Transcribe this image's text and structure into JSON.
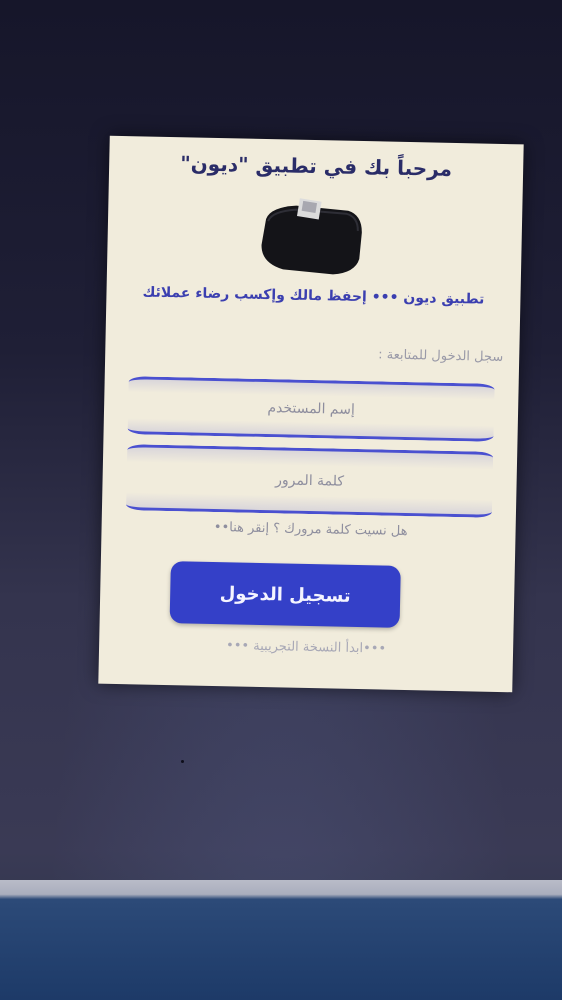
{
  "login": {
    "title": "مرحباً بك في تطبيق \"ديون\"",
    "printer_icon": "receipt-printer-icon",
    "tagline": "تطبيق ديون ••• إحفظ مالك وإكسب رضاء عملائك",
    "prompt": "سجل الدخول للمتابعة :",
    "username_placeholder": "إسم المستخدم",
    "password_placeholder": "كلمة المرور",
    "forgot_link": "هل نسيت كلمة مرورك ؟ إنقر هنا••",
    "login_button": "تسجيل الدخول",
    "trial_link": "•••ابدأ النسخة التجريبية •••"
  },
  "colors": {
    "accent": "#3440c8",
    "title_text": "#2a2c68",
    "card_background": "#f1ecdc"
  }
}
